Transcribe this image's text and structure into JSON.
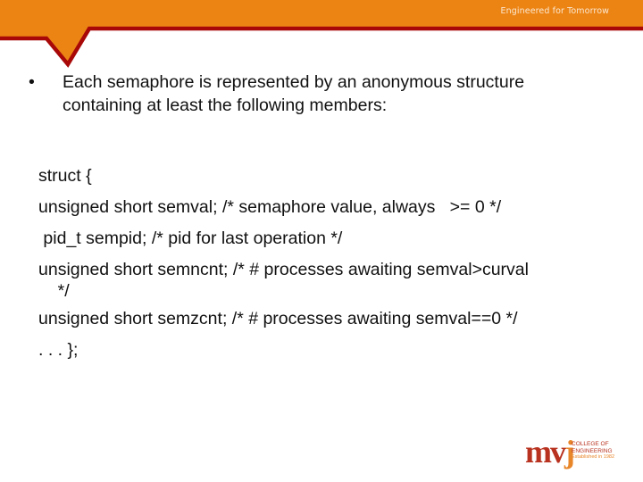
{
  "header": {
    "tagline": "Engineered for Tomorrow",
    "colors": {
      "orange": "#ec8414",
      "red": "#a80808"
    }
  },
  "slide": {
    "bullet": "Each semaphore is represented by an anonymous structure containing at least the following members:",
    "code_lines": [
      "struct {",
      "unsigned short semval; /* semaphore value, always   >= 0 */",
      " pid_t sempid; /* pid for last operation */",
      "unsigned short semncnt; /* # processes awaiting semval>curval",
      "    */",
      "unsigned short semzcnt; /* # processes awaiting semval==0 */",
      ". . . };"
    ]
  },
  "logo": {
    "mark_m_v": "mv",
    "mark_j": "j",
    "line1": "COLLEGE OF",
    "line2": "ENGINEERING",
    "line3": "Established in 1982"
  }
}
